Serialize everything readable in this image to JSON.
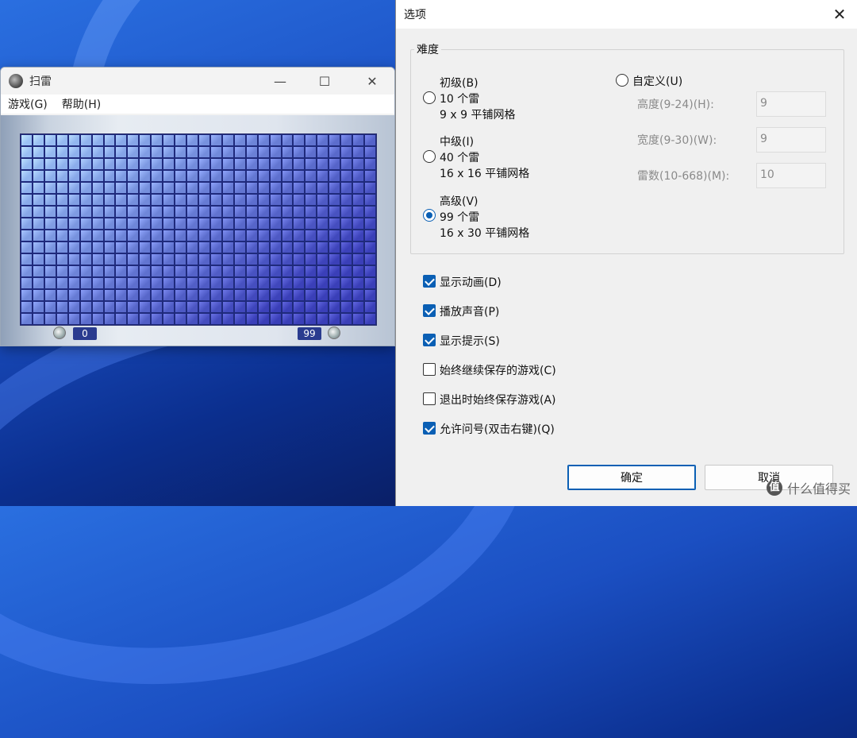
{
  "minesweeper": {
    "title": "扫雷",
    "menu": [
      "游戏(G)",
      "帮助(H)"
    ],
    "window_controls": {
      "minimize": "—",
      "maximize": "☐",
      "close": "✕"
    },
    "grid": {
      "rows": 16,
      "cols": 30
    },
    "timer": "0",
    "mines_remaining": "99"
  },
  "options_dialog": {
    "title": "选项",
    "close": "✕",
    "difficulty_group": "难度",
    "levels": [
      {
        "line1": "初级(B)",
        "line2": "10 个雷",
        "line3": "9 x 9 平铺网格",
        "checked": false
      },
      {
        "line1": "中级(I)",
        "line2": "40 个雷",
        "line3": "16 x 16 平铺网格",
        "checked": false
      },
      {
        "line1": "高级(V)",
        "line2": "99 个雷",
        "line3": "16 x 30 平铺网格",
        "checked": true
      }
    ],
    "custom": {
      "label": "自定义(U)",
      "checked": false,
      "height_label": "高度(9-24)(H):",
      "height_value": "9",
      "width_label": "宽度(9-30)(W):",
      "width_value": "9",
      "mines_label": "雷数(10-668)(M):",
      "mines_value": "10"
    },
    "checkboxes": [
      {
        "label": "显示动画(D)",
        "checked": true
      },
      {
        "label": "播放声音(P)",
        "checked": true
      },
      {
        "label": "显示提示(S)",
        "checked": true
      },
      {
        "label": "始终继续保存的游戏(C)",
        "checked": false
      },
      {
        "label": "退出时始终保存游戏(A)",
        "checked": false
      },
      {
        "label": "允许问号(双击右键)(Q)",
        "checked": true
      }
    ],
    "ok_button": "确定",
    "cancel_button": "取消"
  },
  "watermark": {
    "badge": "值",
    "text": "什么值得买"
  },
  "colors": {
    "accent": "#0a5fb4",
    "tile_light": "#9cc3f5",
    "tile_dark": "#3a3fb8"
  }
}
